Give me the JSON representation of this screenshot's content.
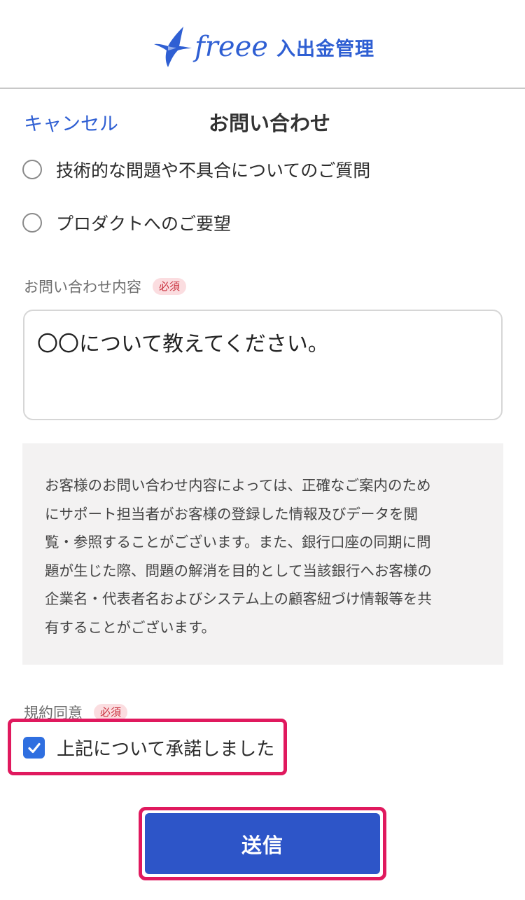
{
  "header": {
    "brand": "freee",
    "product": "入出金管理",
    "brand_color": "#2f5fd3"
  },
  "nav": {
    "cancel_label": "キャンセル",
    "title": "お問い合わせ"
  },
  "inquiry_types": [
    {
      "label": "技術的な問題や不具合についてのご質問",
      "selected": false
    },
    {
      "label": "プロダクトへのご要望",
      "selected": false
    }
  ],
  "content_field": {
    "label": "お問い合わせ内容",
    "required_badge": "必須",
    "value": "〇〇について教えてください。"
  },
  "notice": {
    "lines": [
      "お客様のお問い合わせ内容によっては、正確なご案内のため",
      "にサポート担当者がお客様の登録した情報及びデータを閲",
      "覧・参照することがございます。また、銀行口座の同期に問",
      "題が生じた際、問題の解消を目的として当該銀行へお客様の",
      "企業名・代表者名およびシステム上の顧客紐づけ情報等を共",
      "有することがございます。"
    ]
  },
  "agreement": {
    "label": "規約同意",
    "required_badge": "必須",
    "checkbox_label": "上記について承諾しました",
    "checked": true,
    "checkbox_color": "#2f6fe0",
    "highlight_color": "#e0195e"
  },
  "submit": {
    "label": "送信",
    "color": "#2d55c8"
  }
}
